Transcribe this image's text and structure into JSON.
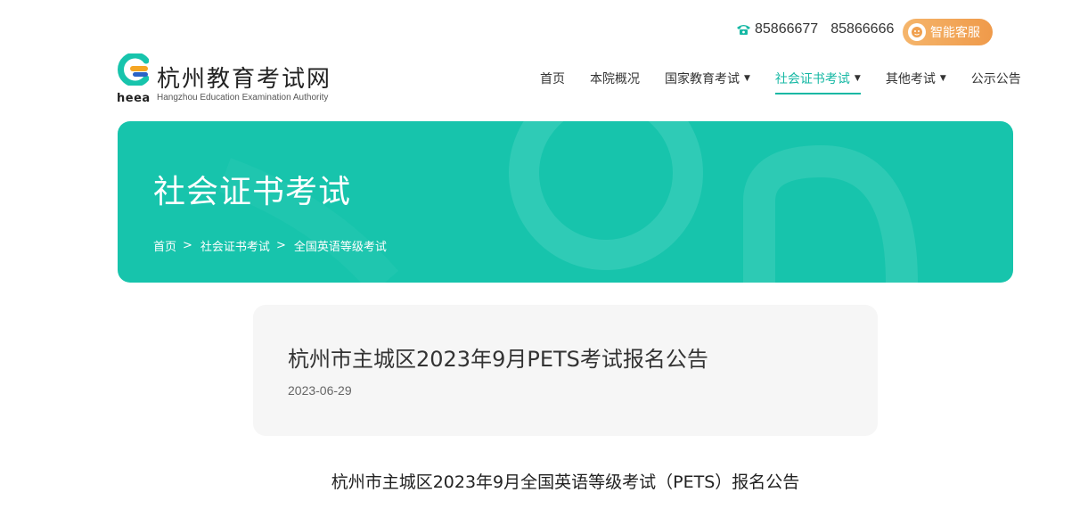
{
  "contact": {
    "phone1": "85866677",
    "phone2": "85866666",
    "service_label": "智能客服"
  },
  "logo": {
    "abbr": "heea",
    "name": "杭州教育考试网",
    "english": "Hangzhou Education Examination Authority"
  },
  "nav": {
    "items": [
      {
        "label": "首页",
        "has_caret": false,
        "active": false
      },
      {
        "label": "本院概况",
        "has_caret": false,
        "active": false
      },
      {
        "label": "国家教育考试",
        "has_caret": true,
        "active": false
      },
      {
        "label": "社会证书考试",
        "has_caret": true,
        "active": true
      },
      {
        "label": "其他考试",
        "has_caret": true,
        "active": false
      },
      {
        "label": "公示公告",
        "has_caret": false,
        "active": false
      }
    ]
  },
  "banner": {
    "title": "社会证书考试",
    "breadcrumb": [
      "首页",
      "社会证书考试",
      "全国英语等级考试"
    ],
    "separator": ">"
  },
  "article": {
    "title": "杭州市主城区2023年9月PETS考试报名公告",
    "date": "2023-06-29",
    "body_heading": "杭州市主城区2023年9月全国英语等级考试（PETS）报名公告"
  },
  "colors": {
    "accent": "#16b8a4",
    "banner": "#17c4ac",
    "service": "#ef9a4a"
  }
}
